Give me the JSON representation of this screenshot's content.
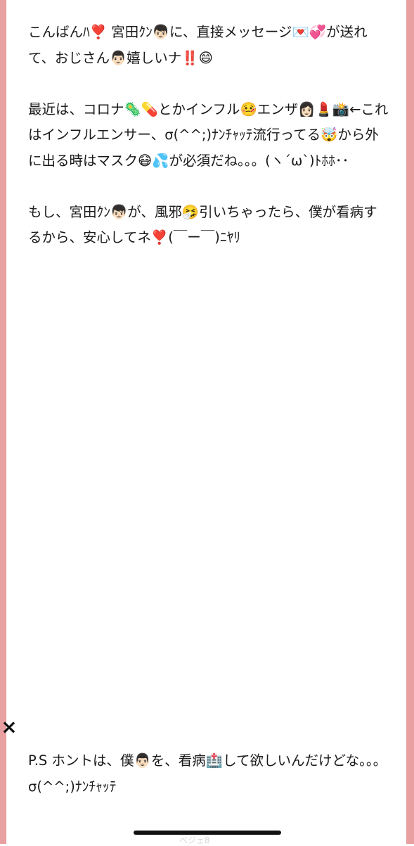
{
  "message": {
    "paragraphs": [
      "こんばんﾊ❣️ 宮田ｸﾝ👦🏻に、直接メッセージ💌💞が送れて、おじさん👨🏻嬉しいナ‼️😄",
      "最近は、コロナ🦠💊とかインフル🤒エンザ👩🏻💄📸←これはインフルエンサー、σ(^^;)ﾅﾝﾁｬｯﾃ流行ってる🤯から外に出る時はマスク😷💦が必須だね。。。(ヽ´ω`)ﾄﾎﾎ･･",
      "もし、宮田ｸﾝ👦🏻が、風邪🤧引いちゃったら、僕が看病するから、安心してネ❣️(￣ー￣)ﾆﾔﾘ"
    ],
    "ps": "P.S ホントは、僕👨🏻を、看病🏥して欲しいんだけどな。。。σ(^^;)ﾅﾝﾁｬｯﾃ"
  },
  "controls": {
    "close_icon": "×",
    "faint_label": "ベジェ8"
  },
  "colors": {
    "side_border": "#e8a0a0",
    "text": "#1a1a1a",
    "background": "#ffffff"
  }
}
